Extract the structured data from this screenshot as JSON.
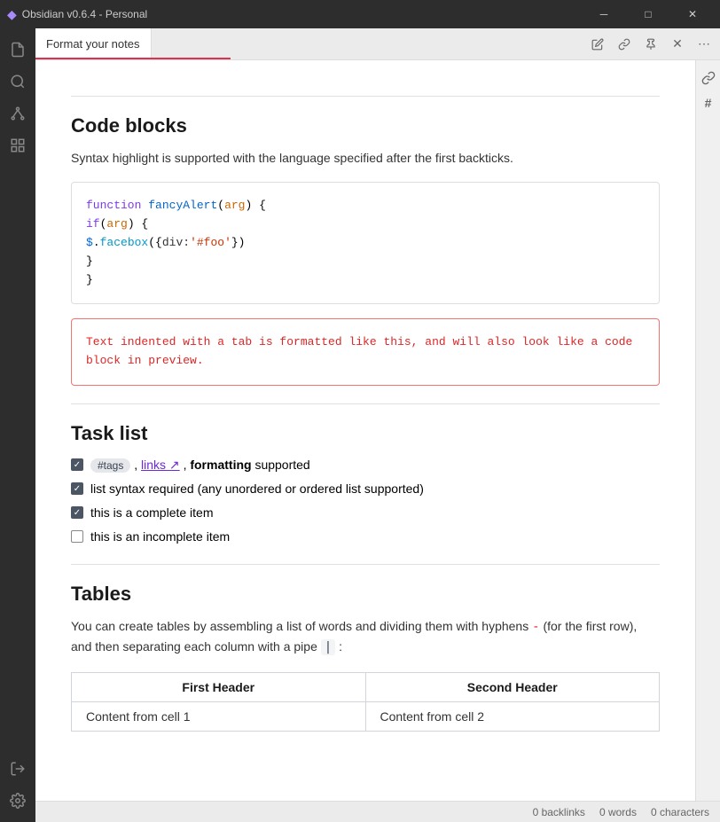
{
  "titleBar": {
    "icon": "◆",
    "title": "Obsidian v0.6.4 - Personal",
    "minimize": "─",
    "maximize": "□",
    "close": "✕"
  },
  "sidebar": {
    "icons": [
      {
        "name": "file-icon",
        "glyph": "📄"
      },
      {
        "name": "search-icon",
        "glyph": "🔍"
      },
      {
        "name": "graph-icon",
        "glyph": "⬡"
      },
      {
        "name": "blocks-icon",
        "glyph": "⊞"
      },
      {
        "name": "logout-icon",
        "glyph": "⇥"
      },
      {
        "name": "settings-icon",
        "glyph": "⚙"
      }
    ]
  },
  "tabBar": {
    "tab_label": "Format your notes",
    "actions": {
      "edit": "✎",
      "link": "🔗",
      "pin": "📌",
      "close": "✕",
      "more": "⋯"
    }
  },
  "rightPanel": {
    "backlinks_icon": "🔗",
    "tag_icon": "#"
  },
  "content": {
    "divider1": "",
    "codeBlocks": {
      "heading": "Code blocks",
      "description": "Syntax highlight is supported with the language specified after the first backticks.",
      "block1": {
        "line1": "function fancyAlert(arg) {",
        "line2": "  if(arg) {",
        "line3": "    $.facebox({div:'#foo'})",
        "line4": "  }",
        "line5": "}"
      },
      "block2": "Text indented with a tab is formatted like this, and will also look like a code block in preview."
    },
    "taskList": {
      "heading": "Task list",
      "items": [
        {
          "id": "item1",
          "checked": true,
          "parts": [
            {
              "type": "tag",
              "text": "#tags"
            },
            {
              "type": "text",
              "text": ", "
            },
            {
              "type": "link",
              "text": "links"
            },
            {
              "type": "text",
              "text": ", "
            },
            {
              "type": "bold",
              "text": "formatting"
            },
            {
              "type": "text",
              "text": " supported"
            }
          ]
        },
        {
          "id": "item2",
          "checked": true,
          "text": "list syntax required (any unordered or ordered list supported)"
        },
        {
          "id": "item3",
          "checked": true,
          "text": "this is a complete item"
        },
        {
          "id": "item4",
          "checked": false,
          "text": "this is an incomplete item"
        }
      ]
    },
    "tables": {
      "heading": "Tables",
      "description_parts": [
        {
          "type": "text",
          "text": "You can create tables by assembling a list of words and dividing them with hyphens "
        },
        {
          "type": "red",
          "text": "-"
        },
        {
          "type": "text",
          "text": " (for the first row), and then separating each column with a pipe "
        },
        {
          "type": "code",
          "text": "|"
        },
        {
          "type": "text",
          "text": " :"
        }
      ],
      "headers": [
        "First Header",
        "Second Header"
      ],
      "rows": [
        [
          "Content from cell 1",
          "Content from cell 2"
        ]
      ]
    }
  },
  "statusBar": {
    "backlinks": "0 backlinks",
    "words": "0 words",
    "characters": "0 characters"
  }
}
